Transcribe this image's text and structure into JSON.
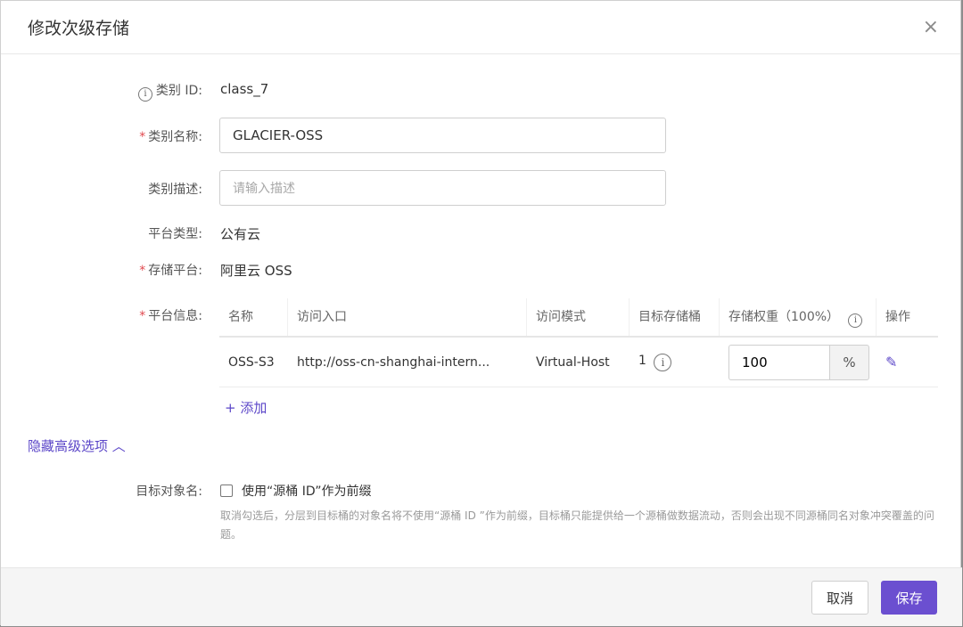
{
  "dialog": {
    "title": "修改次级存储",
    "close_glyph": "×"
  },
  "form": {
    "class_id_label": "类别 ID:",
    "class_id_value": "class_7",
    "class_name_label": "类别名称:",
    "class_name_value": "GLACIER-OSS",
    "class_desc_label": "类别描述:",
    "class_desc_placeholder": "请输入描述",
    "platform_type_label": "平台类型:",
    "platform_type_value": "公有云",
    "storage_platform_label": "存储平台:",
    "storage_platform_value": "阿里云 OSS",
    "platform_info_label": "平台信息:",
    "required_mark": "*",
    "info_glyph": "i"
  },
  "platform_table": {
    "headers": [
      "名称",
      "访问入口",
      "访问模式",
      "目标存储桶",
      "存储权重（100%）",
      "操作"
    ],
    "rows": [
      {
        "name": "OSS-S3",
        "endpoint": "http://oss-cn-shanghai-intern...",
        "mode": "Virtual-Host",
        "bucket_count": "1",
        "weight": "100",
        "weight_unit": "%"
      }
    ]
  },
  "add_label": "+ 添加",
  "advanced": {
    "toggle_label": "隐藏高级选项",
    "toggle_glyph": "︿",
    "target_object_label": "目标对象名:",
    "checkbox_label": "使用“源桶 ID”作为前缀",
    "checkbox_checked": false,
    "help_text": "取消勾选后，分层到目标桶的对象名将不使用“源桶 ID ”作为前缀，目标桶只能提供给一个源桶做数据流动，否则会出现不同源桶同名对象冲突覆盖的问题。"
  },
  "footer": {
    "cancel_label": "取消",
    "save_label": "保存"
  },
  "colors": {
    "accent": "#6b4fd0",
    "required": "#e0484e"
  }
}
